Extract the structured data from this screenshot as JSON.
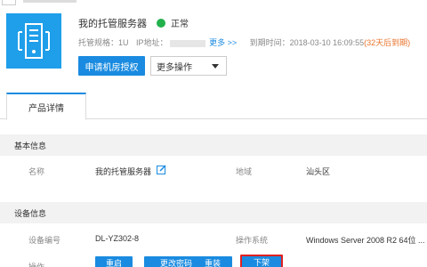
{
  "server": {
    "name": "我的托管服务器",
    "status": "正常",
    "spec_label": "托管规格：1U",
    "ip_label": "IP地址：",
    "more_link": "更多 >>",
    "expire_label": "到期时间：2018-03-10 16:09:55",
    "expire_note": "(32天后到期)"
  },
  "actions": {
    "apply": "申请机房授权",
    "more_ops": "更多操作"
  },
  "tabs": [
    {
      "label": "产品详情"
    }
  ],
  "basic": {
    "title": "基本信息",
    "name_key": "名称",
    "name_val": "我的托管服务器",
    "region_key": "地域",
    "region_val": "汕头区"
  },
  "device": {
    "title": "设备信息",
    "id_key": "设备编号",
    "id_val": "DL-YZ302-8",
    "os_key": "操作系统",
    "os_val": "Windows Server 2008 R2 64位 ...",
    "ops_key": "操作"
  },
  "device_buttons": [
    "重启",
    "更改密码",
    "重装",
    "下架"
  ],
  "colors": {
    "accent": "#1a8be0",
    "status": "#22b14c",
    "warning": "#e8722a",
    "highlight": "#e02020"
  }
}
